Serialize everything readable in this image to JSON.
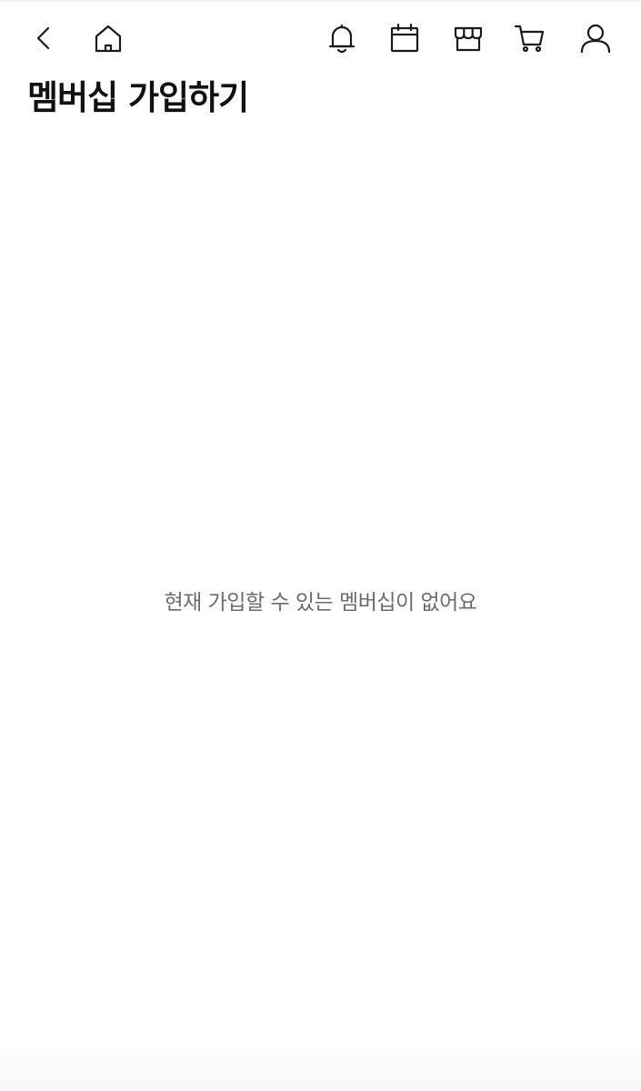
{
  "header": {
    "icons": [
      "chevron-left-icon",
      "home-icon",
      "bell-icon",
      "calendar-icon",
      "store-icon",
      "cart-icon",
      "user-icon"
    ],
    "title": "멤버십 가입하기"
  },
  "main": {
    "empty_message": "현재 가입할 수 있는 멤버십이 없어요"
  },
  "colors": {
    "icon": "#1a1a1a",
    "title": "#111111",
    "empty_text": "#6b6b6b",
    "background": "#ffffff"
  }
}
